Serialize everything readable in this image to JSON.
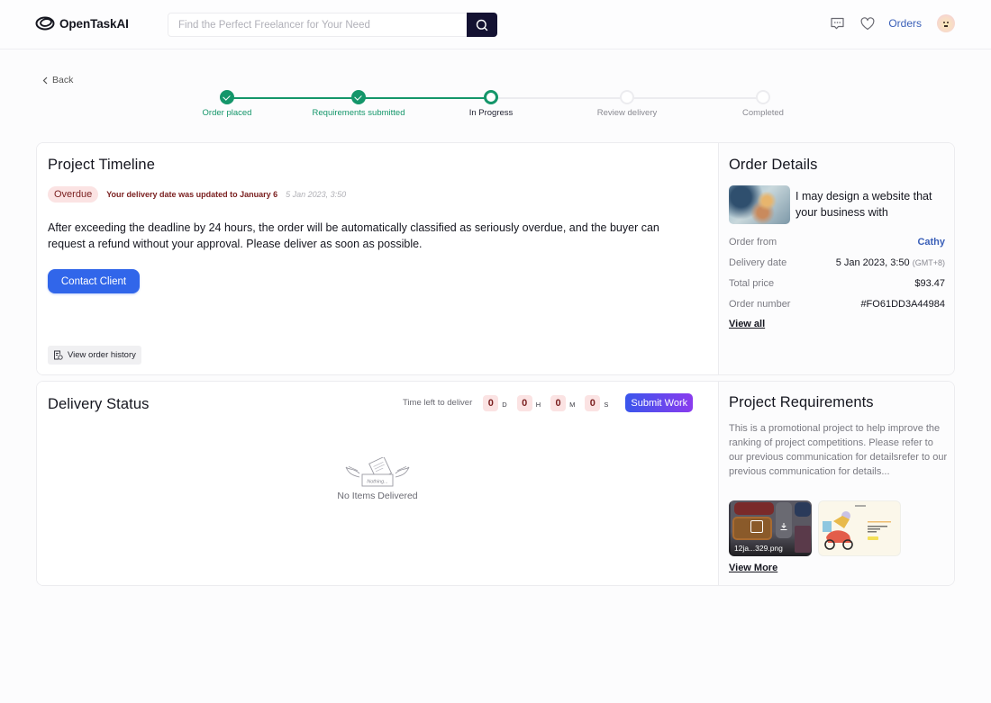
{
  "header": {
    "brand": "OpenTaskAI",
    "search_placeholder": "Find the Perfect Freelancer for Your Need",
    "search_icon": "search-icon",
    "icons": [
      "chat-icon",
      "heart-icon"
    ],
    "orders_label": "Orders",
    "avatar_icon": "avatar"
  },
  "back_label": "Back",
  "stepper": {
    "accent": "#14966a",
    "steps": [
      {
        "label": "Order placed",
        "state": "done"
      },
      {
        "label": "Requirements submitted",
        "state": "done"
      },
      {
        "label": "In Progress",
        "state": "current"
      },
      {
        "label": "Review delivery",
        "state": "todo"
      },
      {
        "label": "Completed",
        "state": "todo"
      }
    ]
  },
  "timeline": {
    "title": "Project Timeline",
    "badge": "Overdue",
    "update_text": "Your delivery date was updated to January 6",
    "update_time": "5 Jan 2023, 3:50",
    "body": "After exceeding the deadline by 24 hours, the order will be automatically classified as seriously overdue, and the buyer can request a refund without your approval. Please deliver as soon as possible.",
    "contact_button": "Contact Client",
    "history_button": "View order history"
  },
  "order_details": {
    "title": "Order Details",
    "gig_title": "I may design a website that your business with",
    "rows": [
      {
        "label": "Order from",
        "value": "Cathy"
      },
      {
        "label": "Delivery date",
        "value": "5 Jan 2023, 3:50",
        "suffix": "(GMT+8)"
      },
      {
        "label": "Total price",
        "value": "$93.47"
      },
      {
        "label": "Order number",
        "value": "#FO61DD3A44984"
      }
    ],
    "view_all": "View all"
  },
  "delivery": {
    "title": "Delivery Status",
    "timer_label": "Time left to deliver",
    "timer": [
      {
        "value": "0",
        "unit": "D"
      },
      {
        "value": "0",
        "unit": "H"
      },
      {
        "value": "0",
        "unit": "M"
      },
      {
        "value": "0",
        "unit": "S"
      }
    ],
    "submit_button": "Submit Work",
    "empty_illustration_text": "Nothing...",
    "empty_text": "No Items Delivered"
  },
  "requirements": {
    "title": "Project Requirements",
    "text": "This is a promotional project to help improve the ranking of project competitions. Please refer to our previous communication for detailsrefer to our previous communication for details...",
    "files": [
      {
        "name": "12ja...329.png"
      },
      {
        "name": ""
      }
    ],
    "view_more": "View More"
  },
  "colors": {
    "primary_button": "#3166ea",
    "overdue_bg": "#fbe3e3",
    "overdue_text": "#7a1f1f",
    "link": "#3a5fb8",
    "search_button": "#141232"
  }
}
